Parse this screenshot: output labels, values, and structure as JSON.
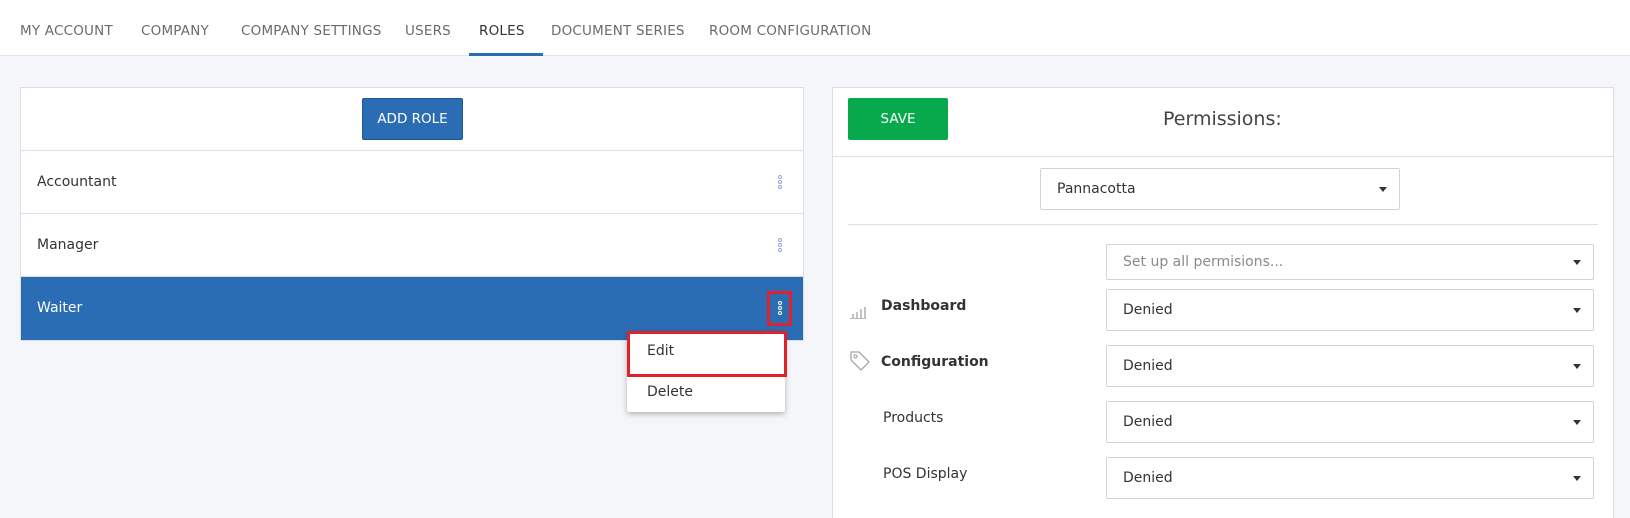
{
  "nav": {
    "tabs": [
      {
        "label": "MY ACCOUNT"
      },
      {
        "label": "COMPANY"
      },
      {
        "label": "COMPANY SETTINGS"
      },
      {
        "label": "USERS"
      },
      {
        "label": "ROLES"
      },
      {
        "label": "DOCUMENT SERIES"
      },
      {
        "label": "ROOM CONFIGURATION"
      }
    ],
    "active_tab": "ROLES"
  },
  "roles": {
    "add_button_label": "ADD ROLE",
    "items": [
      {
        "label": "Accountant"
      },
      {
        "label": "Manager"
      },
      {
        "label": "Waiter"
      }
    ],
    "selected": "Waiter",
    "context_menu": {
      "items": [
        {
          "label": "Edit"
        },
        {
          "label": "Delete"
        }
      ],
      "highlighted": "Edit"
    }
  },
  "permissions": {
    "save_label": "SAVE",
    "title": "Permissions:",
    "location_value": "Pannacotta",
    "setup_all_placeholder": "Set up all permisions...",
    "rows": [
      {
        "label": "Dashboard",
        "value": "Denied",
        "icon": "dashboard-icon"
      },
      {
        "label": "Configuration",
        "value": "Denied",
        "icon": "tag-icon"
      },
      {
        "label": "Products",
        "value": "Denied"
      },
      {
        "label": "POS Display",
        "value": "Denied"
      }
    ]
  },
  "colors": {
    "primary": "#2b6db4",
    "save": "#08a94c",
    "highlight": "#e0222b"
  }
}
